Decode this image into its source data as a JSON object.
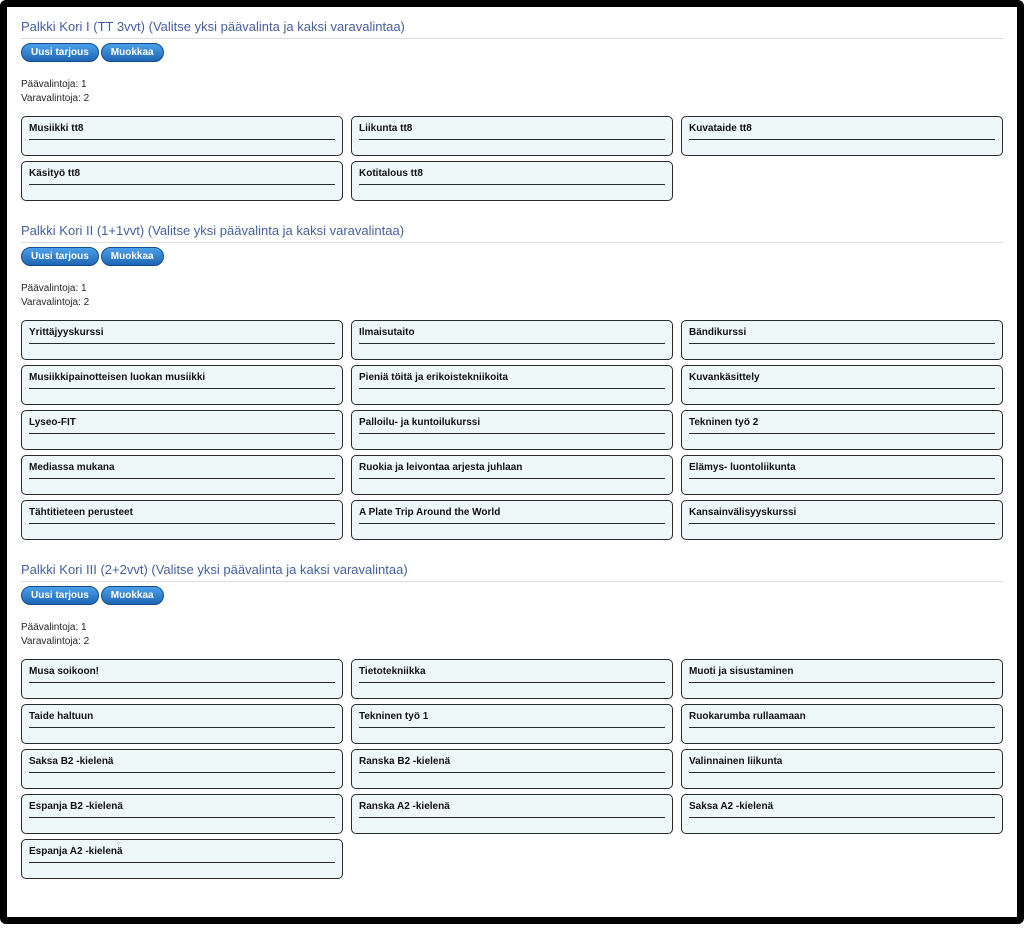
{
  "labels": {
    "new_offer": "Uusi tarjous",
    "edit": "Muokkaa",
    "primary_count_prefix": "Päävalintoja: ",
    "spare_count_prefix": "Varavalintoja: "
  },
  "sections": [
    {
      "title": "Palkki Kori I (TT 3vvt) (Valitse yksi päävalinta ja kaksi varavalintaa)",
      "primary": 1,
      "spare": 2,
      "courses": [
        "Musiikki tt8",
        "Liikunta tt8",
        "Kuvataide tt8",
        "Käsityö tt8",
        "Kotitalous tt8"
      ]
    },
    {
      "title": "Palkki Kori II (1+1vvt) (Valitse yksi päävalinta ja kaksi varavalintaa)",
      "primary": 1,
      "spare": 2,
      "courses": [
        "Yrittäjyyskurssi",
        "Ilmaisutaito",
        "Bändikurssi",
        "Musiikkipainotteisen luokan musiikki",
        "Pieniä töitä ja erikoistekniikoita",
        "Kuvankäsittely",
        "Lyseo-FIT",
        "Palloilu- ja kuntoilukurssi",
        "Tekninen työ 2",
        "Mediassa mukana",
        "Ruokia ja leivontaa arjesta juhlaan",
        "Elämys- luontoliikunta",
        "Tähtitieteen perusteet",
        "A Plate Trip Around the World",
        "Kansainvälisyyskurssi"
      ]
    },
    {
      "title": "Palkki Kori III (2+2vvt) (Valitse yksi päävalinta ja kaksi varavalintaa)",
      "primary": 1,
      "spare": 2,
      "courses": [
        "Musa soikoon!",
        "Tietotekniikka",
        "Muoti ja sisustaminen",
        "Taide haltuun",
        "Tekninen työ 1",
        "Ruokarumba rullaamaan",
        "Saksa B2 -kielenä",
        "Ranska B2 -kielenä",
        "Valinnainen liikunta",
        "Espanja B2 -kielenä",
        "Ranska A2 -kielenä",
        "Saksa A2 -kielenä",
        "Espanja A2 -kielenä"
      ]
    }
  ]
}
